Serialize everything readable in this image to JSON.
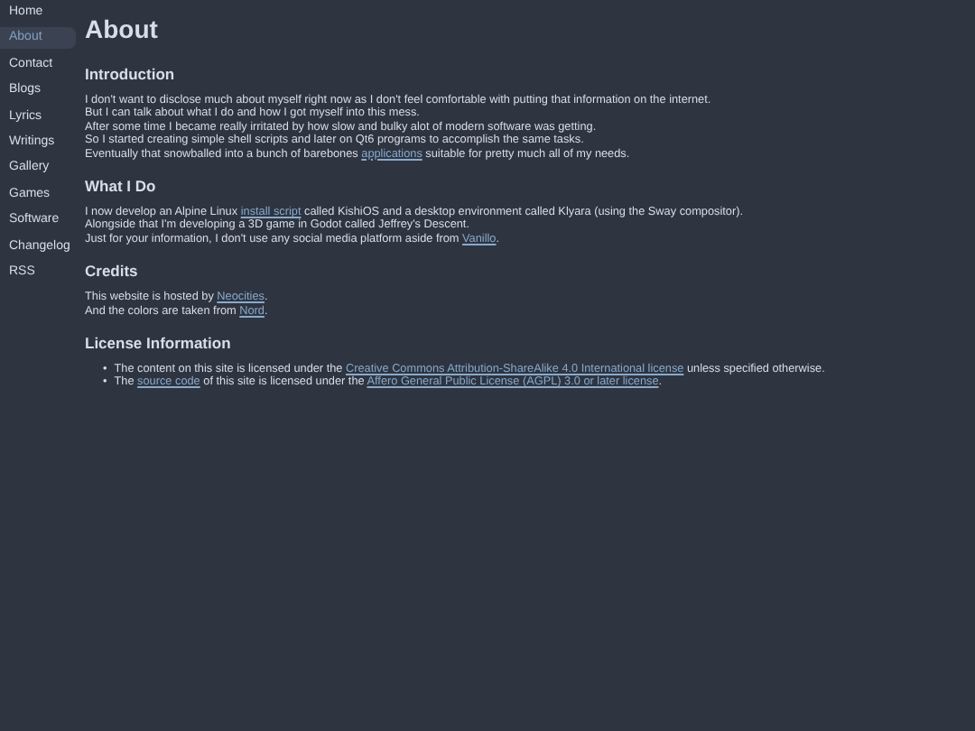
{
  "sidebar": {
    "items": [
      {
        "label": "Home",
        "selected": false
      },
      {
        "label": "About",
        "selected": true
      },
      {
        "label": "Contact",
        "selected": false
      },
      {
        "label": "Blogs",
        "selected": false
      },
      {
        "label": "Lyrics",
        "selected": false
      },
      {
        "label": "Writings",
        "selected": false
      },
      {
        "label": "Gallery",
        "selected": false
      },
      {
        "label": "Games",
        "selected": false
      },
      {
        "label": "Software",
        "selected": false
      },
      {
        "label": "Changelog",
        "selected": false
      },
      {
        "label": "RSS",
        "selected": false
      }
    ]
  },
  "page": {
    "title": "About",
    "sections": [
      {
        "heading": "Introduction",
        "kind": "lines",
        "lines": [
          [
            {
              "kind": "text",
              "text": "I don't want to disclose much about myself right now as I don't feel comfortable with putting that information on the internet."
            }
          ],
          [
            {
              "kind": "text",
              "text": "But I can talk about what I do and how I got myself into this mess."
            }
          ],
          [
            {
              "kind": "text",
              "text": "After some time I became really irritated by how slow and bulky alot of modern software was getting."
            }
          ],
          [
            {
              "kind": "text",
              "text": "So I started creating simple shell scripts and later on Qt6 programs to accomplish the same tasks."
            }
          ],
          [
            {
              "kind": "text",
              "text": "Eventually that snowballed into a bunch of barebones "
            },
            {
              "kind": "link",
              "text": "applications"
            },
            {
              "kind": "text",
              "text": " suitable for pretty much all of my needs."
            }
          ]
        ]
      },
      {
        "heading": "What I Do",
        "kind": "lines",
        "lines": [
          [
            {
              "kind": "text",
              "text": "I now develop an Alpine Linux "
            },
            {
              "kind": "link",
              "text": "install script"
            },
            {
              "kind": "text",
              "text": " called KishiOS and a desktop environment called Klyara (using the Sway compositor)."
            }
          ],
          [
            {
              "kind": "text",
              "text": "Alongside that I'm developing a 3D game in Godot called Jeffrey's Descent."
            }
          ],
          [
            {
              "kind": "text",
              "text": "Just for your information, I don't use any social media platform aside from "
            },
            {
              "kind": "link",
              "text": "Vanillo"
            },
            {
              "kind": "text",
              "text": "."
            }
          ]
        ]
      },
      {
        "heading": "Credits",
        "kind": "lines",
        "lines": [
          [
            {
              "kind": "text",
              "text": "This website is hosted by "
            },
            {
              "kind": "link",
              "text": "Neocities"
            },
            {
              "kind": "text",
              "text": "."
            }
          ],
          [
            {
              "kind": "text",
              "text": "And the colors are taken from "
            },
            {
              "kind": "link",
              "text": "Nord"
            },
            {
              "kind": "text",
              "text": "."
            }
          ]
        ]
      },
      {
        "heading": "License Information",
        "kind": "bullets",
        "lines": [
          [
            {
              "kind": "bullet",
              "text": "•"
            },
            {
              "kind": "text",
              "text": "The content on this site is licensed under the "
            },
            {
              "kind": "link",
              "text": "Creative Commons Attribution-ShareAlike 4.0 International license"
            },
            {
              "kind": "text",
              "text": " unless specified otherwise."
            }
          ],
          [
            {
              "kind": "bullet",
              "text": "•"
            },
            {
              "kind": "text",
              "text": "The "
            },
            {
              "kind": "link",
              "text": "source code"
            },
            {
              "kind": "text",
              "text": " of this site is licensed under the "
            },
            {
              "kind": "link",
              "text": "Affero General Public License (AGPL) 3.0 or later license"
            },
            {
              "kind": "text",
              "text": "."
            }
          ]
        ]
      }
    ]
  }
}
